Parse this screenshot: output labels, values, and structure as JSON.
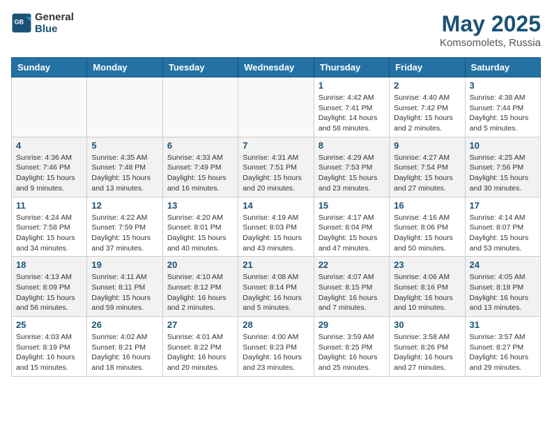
{
  "header": {
    "logo_general": "General",
    "logo_blue": "Blue",
    "month": "May 2025",
    "location": "Komsomolets, Russia"
  },
  "days_of_week": [
    "Sunday",
    "Monday",
    "Tuesday",
    "Wednesday",
    "Thursday",
    "Friday",
    "Saturday"
  ],
  "weeks": [
    [
      {
        "day": "",
        "info": ""
      },
      {
        "day": "",
        "info": ""
      },
      {
        "day": "",
        "info": ""
      },
      {
        "day": "",
        "info": ""
      },
      {
        "day": "1",
        "info": "Sunrise: 4:42 AM\nSunset: 7:41 PM\nDaylight: 14 hours\nand 58 minutes."
      },
      {
        "day": "2",
        "info": "Sunrise: 4:40 AM\nSunset: 7:42 PM\nDaylight: 15 hours\nand 2 minutes."
      },
      {
        "day": "3",
        "info": "Sunrise: 4:38 AM\nSunset: 7:44 PM\nDaylight: 15 hours\nand 5 minutes."
      }
    ],
    [
      {
        "day": "4",
        "info": "Sunrise: 4:36 AM\nSunset: 7:46 PM\nDaylight: 15 hours\nand 9 minutes."
      },
      {
        "day": "5",
        "info": "Sunrise: 4:35 AM\nSunset: 7:48 PM\nDaylight: 15 hours\nand 13 minutes."
      },
      {
        "day": "6",
        "info": "Sunrise: 4:33 AM\nSunset: 7:49 PM\nDaylight: 15 hours\nand 16 minutes."
      },
      {
        "day": "7",
        "info": "Sunrise: 4:31 AM\nSunset: 7:51 PM\nDaylight: 15 hours\nand 20 minutes."
      },
      {
        "day": "8",
        "info": "Sunrise: 4:29 AM\nSunset: 7:53 PM\nDaylight: 15 hours\nand 23 minutes."
      },
      {
        "day": "9",
        "info": "Sunrise: 4:27 AM\nSunset: 7:54 PM\nDaylight: 15 hours\nand 27 minutes."
      },
      {
        "day": "10",
        "info": "Sunrise: 4:25 AM\nSunset: 7:56 PM\nDaylight: 15 hours\nand 30 minutes."
      }
    ],
    [
      {
        "day": "11",
        "info": "Sunrise: 4:24 AM\nSunset: 7:58 PM\nDaylight: 15 hours\nand 34 minutes."
      },
      {
        "day": "12",
        "info": "Sunrise: 4:22 AM\nSunset: 7:59 PM\nDaylight: 15 hours\nand 37 minutes."
      },
      {
        "day": "13",
        "info": "Sunrise: 4:20 AM\nSunset: 8:01 PM\nDaylight: 15 hours\nand 40 minutes."
      },
      {
        "day": "14",
        "info": "Sunrise: 4:19 AM\nSunset: 8:03 PM\nDaylight: 15 hours\nand 43 minutes."
      },
      {
        "day": "15",
        "info": "Sunrise: 4:17 AM\nSunset: 8:04 PM\nDaylight: 15 hours\nand 47 minutes."
      },
      {
        "day": "16",
        "info": "Sunrise: 4:16 AM\nSunset: 8:06 PM\nDaylight: 15 hours\nand 50 minutes."
      },
      {
        "day": "17",
        "info": "Sunrise: 4:14 AM\nSunset: 8:07 PM\nDaylight: 15 hours\nand 53 minutes."
      }
    ],
    [
      {
        "day": "18",
        "info": "Sunrise: 4:13 AM\nSunset: 8:09 PM\nDaylight: 15 hours\nand 56 minutes."
      },
      {
        "day": "19",
        "info": "Sunrise: 4:11 AM\nSunset: 8:11 PM\nDaylight: 15 hours\nand 59 minutes."
      },
      {
        "day": "20",
        "info": "Sunrise: 4:10 AM\nSunset: 8:12 PM\nDaylight: 16 hours\nand 2 minutes."
      },
      {
        "day": "21",
        "info": "Sunrise: 4:08 AM\nSunset: 8:14 PM\nDaylight: 16 hours\nand 5 minutes."
      },
      {
        "day": "22",
        "info": "Sunrise: 4:07 AM\nSunset: 8:15 PM\nDaylight: 16 hours\nand 7 minutes."
      },
      {
        "day": "23",
        "info": "Sunrise: 4:06 AM\nSunset: 8:16 PM\nDaylight: 16 hours\nand 10 minutes."
      },
      {
        "day": "24",
        "info": "Sunrise: 4:05 AM\nSunset: 8:18 PM\nDaylight: 16 hours\nand 13 minutes."
      }
    ],
    [
      {
        "day": "25",
        "info": "Sunrise: 4:03 AM\nSunset: 8:19 PM\nDaylight: 16 hours\nand 15 minutes."
      },
      {
        "day": "26",
        "info": "Sunrise: 4:02 AM\nSunset: 8:21 PM\nDaylight: 16 hours\nand 18 minutes."
      },
      {
        "day": "27",
        "info": "Sunrise: 4:01 AM\nSunset: 8:22 PM\nDaylight: 16 hours\nand 20 minutes."
      },
      {
        "day": "28",
        "info": "Sunrise: 4:00 AM\nSunset: 8:23 PM\nDaylight: 16 hours\nand 23 minutes."
      },
      {
        "day": "29",
        "info": "Sunrise: 3:59 AM\nSunset: 8:25 PM\nDaylight: 16 hours\nand 25 minutes."
      },
      {
        "day": "30",
        "info": "Sunrise: 3:58 AM\nSunset: 8:26 PM\nDaylight: 16 hours\nand 27 minutes."
      },
      {
        "day": "31",
        "info": "Sunrise: 3:57 AM\nSunset: 8:27 PM\nDaylight: 16 hours\nand 29 minutes."
      }
    ]
  ]
}
